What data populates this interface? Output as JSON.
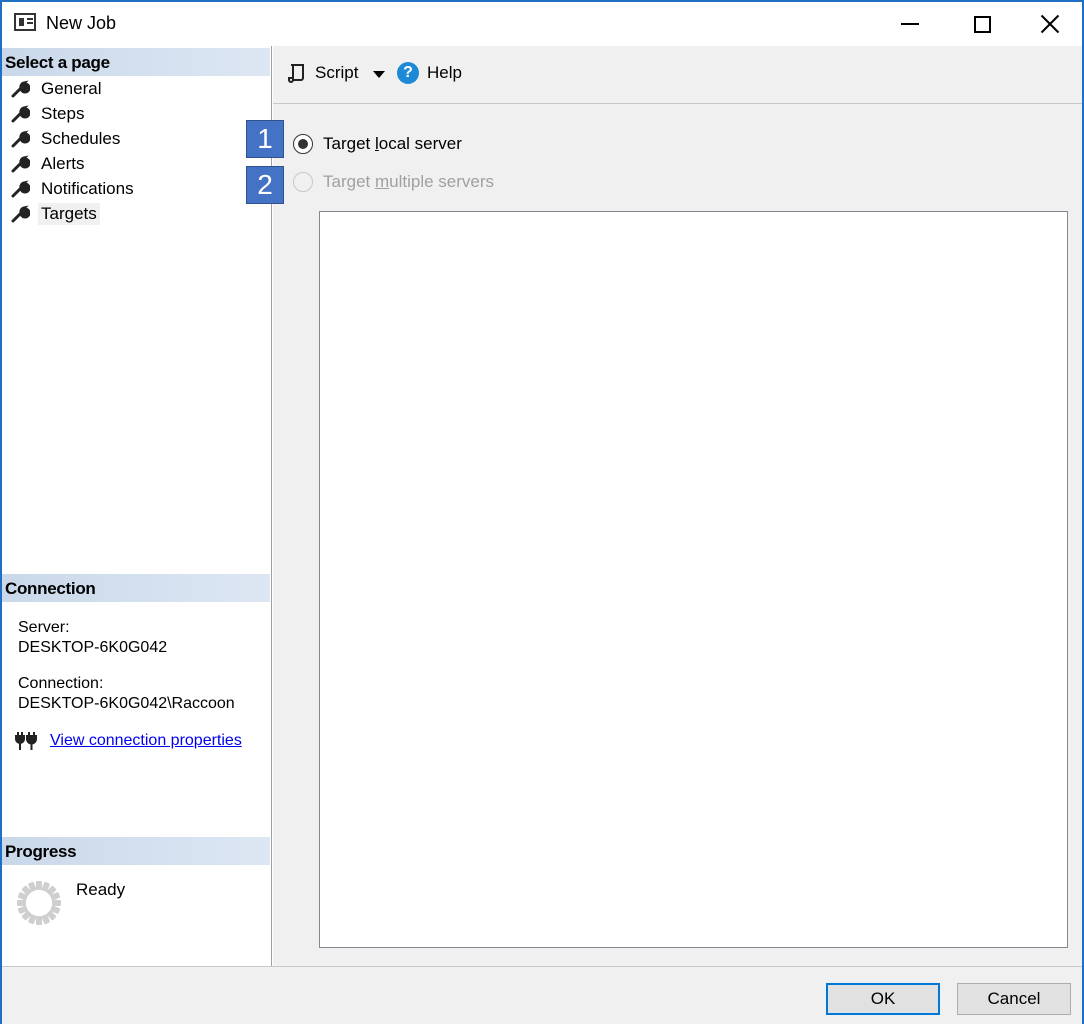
{
  "window": {
    "title": "New Job"
  },
  "left_pane": {
    "select_header": "Select a page",
    "pages": [
      {
        "label": "General"
      },
      {
        "label": "Steps"
      },
      {
        "label": "Schedules"
      },
      {
        "label": "Alerts"
      },
      {
        "label": "Notifications"
      },
      {
        "label": "Targets"
      }
    ],
    "selected_page": "Targets",
    "connection_header": "Connection",
    "server_label": "Server:",
    "server_value": "DESKTOP-6K0G042",
    "connection_label": "Connection:",
    "connection_value": "DESKTOP-6K0G042\\Raccoon",
    "view_connection_link": "View connection properties",
    "progress_header": "Progress",
    "progress_status": "Ready"
  },
  "toolbar": {
    "script_label": "Script",
    "help_label": "Help"
  },
  "badges": [
    "1",
    "2"
  ],
  "targets": {
    "local_prefix": "Target ",
    "local_accel": "l",
    "local_suffix": "ocal server",
    "local_checked": true,
    "multi_prefix": "Target ",
    "multi_accel": "m",
    "multi_suffix": "ultiple servers",
    "multi_enabled": false
  },
  "buttons": {
    "ok": "OK",
    "cancel": "Cancel"
  },
  "colors": {
    "accent": "#0078d7",
    "badge": "#4472c4",
    "link": "#0000ee",
    "window_border": "#1f6fc5"
  }
}
